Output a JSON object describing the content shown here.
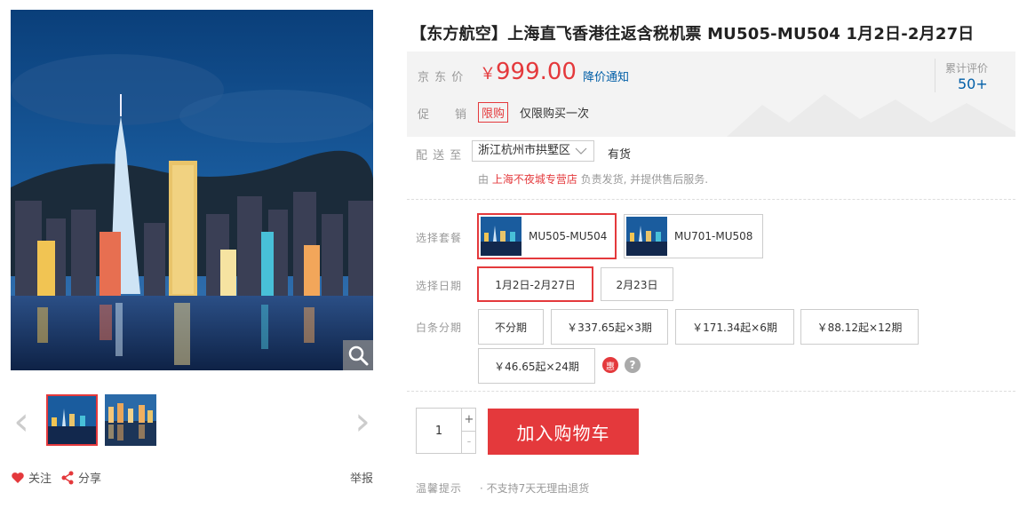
{
  "gallery": {
    "zoom_icon": "magnifier-icon",
    "prev_icon": "chevron-left-icon",
    "next_icon": "chevron-right-icon"
  },
  "social": {
    "follow_label": "关注",
    "share_label": "分享",
    "report_label": "举报"
  },
  "product": {
    "title": "【东方航空】上海直飞香港往返含税机票 MU505-MU504 1月2日-2月27日"
  },
  "price_section": {
    "price_label": "京 东 价",
    "currency": "￥",
    "price": "999.00",
    "notify_label": "降价通知",
    "review_label": "累计评价",
    "review_count": "50+",
    "promo_label": "促　　销",
    "promo_tag": "限购",
    "promo_text": "仅限购买一次"
  },
  "delivery": {
    "label": "配 送 至",
    "location": "浙江杭州市拱墅区",
    "stock": "有货",
    "seller_prefix": "由 ",
    "seller": "上海不夜城专营店",
    "seller_suffix": " 负责发货, 并提供售后服务."
  },
  "packages": {
    "label": "选择套餐",
    "options": [
      "MU505-MU504",
      "MU701-MU508"
    ],
    "selected": 0
  },
  "dates": {
    "label": "选择日期",
    "options": [
      "1月2日-2月27日",
      "2月23日"
    ],
    "selected": 0
  },
  "installments": {
    "label": "白条分期",
    "options": [
      "不分期",
      "￥337.65起×3期",
      "￥171.34起×6期",
      "￥88.12起×12期",
      "￥46.65起×24期"
    ],
    "hui_badge": "惠",
    "help_icon": "question-icon"
  },
  "cart": {
    "quantity": "1",
    "plus": "+",
    "minus": "-",
    "button_label": "加入购物车"
  },
  "tips": {
    "label": "温馨提示",
    "text": "· 不支持7天无理由退货"
  },
  "colors": {
    "accent": "#e4393c",
    "link": "#005ea7"
  }
}
